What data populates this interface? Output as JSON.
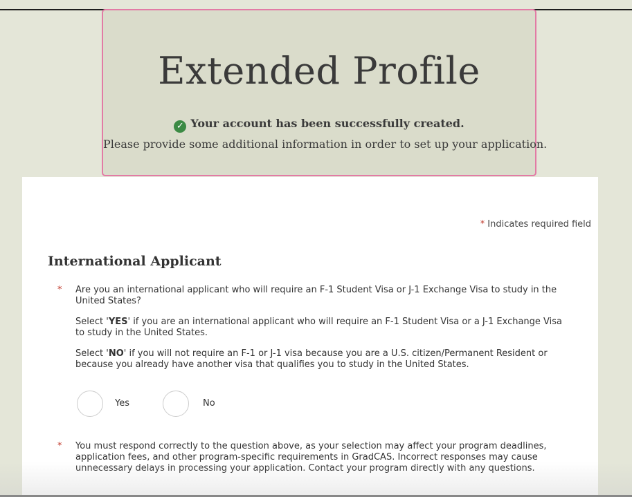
{
  "header": {
    "title": "Extended Profile",
    "success_message": "Your account has been successfully created.",
    "instructions": "Please provide some additional information in order to set up your application."
  },
  "form": {
    "required_note": "Indicates required field",
    "required_marker": "*",
    "section_title": "International Applicant",
    "question": "Are you an international applicant who will require an F-1 Student Visa or J-1 Exchange Visa to study in the United States?",
    "yes_help": {
      "prefix": "Select '",
      "keyword": "YES",
      "suffix": "' if you are an international applicant who will require an F-1 Student Visa or a J-1 Exchange Visa to study in the United States."
    },
    "no_help": {
      "prefix": "Select '",
      "keyword": "NO",
      "suffix": "' if you will not require an F-1 or J-1 visa because you are a U.S. citizen/Permanent Resident or because you already have another visa that qualifies you to study in the United States."
    },
    "options": {
      "yes": "Yes",
      "no": "No"
    },
    "note": "You must respond correctly to the question above, as your selection may affect your program deadlines, application fees, and other program-specific requirements in GradCAS. Incorrect responses may cause unnecessary delays in processing your application. Contact your program directly with any questions."
  },
  "colors": {
    "page_bg": "#e4e6d8",
    "header_border": "#e27ba5",
    "success_green": "#3b8a44",
    "required_red": "#c0392b"
  },
  "icons": {
    "success": "check-circle-icon"
  }
}
